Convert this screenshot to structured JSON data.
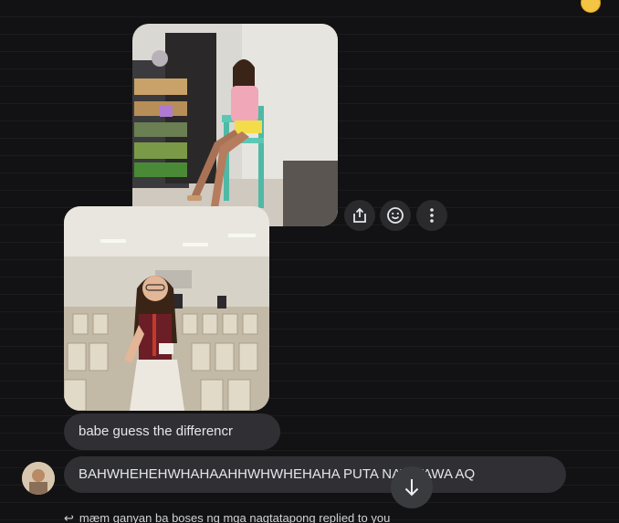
{
  "conversation": {
    "photos": [
      {
        "name": "photo-girl-on-chair",
        "alt": ""
      },
      {
        "name": "photo-woman-in-hall",
        "alt": ""
      }
    ],
    "actions": {
      "share_icon": "share-icon",
      "react_icon": "smiley-icon",
      "more_icon": "more-vertical-icon"
    },
    "messages": [
      {
        "text": "babe guess the differencr"
      },
      {
        "text": "BAHWHEHEHWHAHAAHHWHWHEHAHA PUTA NATATAWA AQ"
      }
    ],
    "reply_notice": "mæm ganyan ba boses ng mga nagtatapong replied to you",
    "colors": {
      "background": "#121214",
      "bubble": "#303034",
      "text": "#e4e6eb"
    }
  }
}
